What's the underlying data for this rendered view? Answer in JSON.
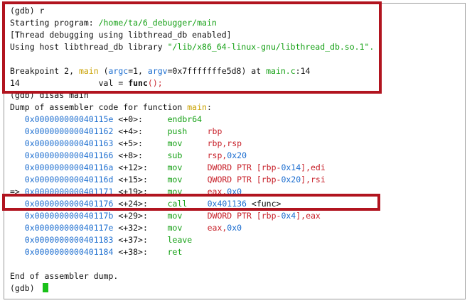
{
  "colors": {
    "address": "#1e6fd0",
    "instruction": "#16a116",
    "register": "#c8232c",
    "function_name": "#c9a100",
    "highlight_box": "#b1141f",
    "cursor": "#19c119"
  },
  "session": {
    "run_cmd": "(gdb) r",
    "starting_label": "Starting program: ",
    "program_path": "/home/ta/6_debugger/main",
    "thread_debug": "[Thread debugging using libthread_db enabled]",
    "host_lib_label": "Using host libthread_db library ",
    "host_lib_path": "\"/lib/x86_64-linux-gnu/libthread_db.so.1\".",
    "bp_label": "Breakpoint 2, ",
    "bp_fn": "main",
    "bp_open": " (",
    "argc_name": "argc",
    "argc_val": "=1, ",
    "argv_name": "argv",
    "argv_val": "=0x7fffffffe5d8) at ",
    "bp_file": "main.c",
    "bp_line": ":14",
    "src_lineno": "14",
    "src_pre": "                val = ",
    "src_func": "func",
    "src_parens": "();",
    "disas_cmd": "(gdb) disas main",
    "dump_label": "Dump of assembler code for function ",
    "dump_fn": "main",
    "dump_colon": ":",
    "end_dump": "End of assembler dump.",
    "prompt": "(gdb) "
  },
  "disassembly": [
    {
      "marker": "   ",
      "address": "0x000000000040115e",
      "offset": "<+0>:",
      "pad": "     ",
      "instr": "endbr64",
      "ops": []
    },
    {
      "marker": "   ",
      "address": "0x0000000000401162",
      "offset": "<+4>:",
      "pad": "     ",
      "instr": "push",
      "ops": [
        {
          "t": "reg",
          "v": "rbp"
        }
      ]
    },
    {
      "marker": "   ",
      "address": "0x0000000000401163",
      "offset": "<+5>:",
      "pad": "     ",
      "instr": "mov",
      "ops": [
        {
          "t": "reg",
          "v": "rbp,rsp"
        }
      ]
    },
    {
      "marker": "   ",
      "address": "0x0000000000401166",
      "offset": "<+8>:",
      "pad": "     ",
      "instr": "sub",
      "ops": [
        {
          "t": "reg",
          "v": "rsp,"
        },
        {
          "t": "num",
          "v": "0x20"
        }
      ]
    },
    {
      "marker": "   ",
      "address": "0x000000000040116a",
      "offset": "<+12>:",
      "pad": "    ",
      "instr": "mov",
      "ops": [
        {
          "t": "reg",
          "v": "DWORD PTR [rbp-"
        },
        {
          "t": "num",
          "v": "0x14"
        },
        {
          "t": "reg",
          "v": "],edi"
        }
      ]
    },
    {
      "marker": "   ",
      "address": "0x000000000040116d",
      "offset": "<+15>:",
      "pad": "    ",
      "instr": "mov",
      "ops": [
        {
          "t": "reg",
          "v": "QWORD PTR [rbp-"
        },
        {
          "t": "num",
          "v": "0x20"
        },
        {
          "t": "reg",
          "v": "],rsi"
        }
      ]
    },
    {
      "marker": "=> ",
      "address": "0x0000000000401171",
      "offset": "<+19>:",
      "pad": "    ",
      "instr": "mov",
      "ops": [
        {
          "t": "reg",
          "v": "eax,"
        },
        {
          "t": "num",
          "v": "0x0"
        }
      ]
    },
    {
      "marker": "   ",
      "address": "0x0000000000401176",
      "offset": "<+24>:",
      "pad": "    ",
      "instr": "call",
      "ops": [
        {
          "t": "num",
          "v": "0x401136"
        },
        {
          "t": "off",
          "v": " <func>"
        }
      ]
    },
    {
      "marker": "   ",
      "address": "0x000000000040117b",
      "offset": "<+29>:",
      "pad": "    ",
      "instr": "mov",
      "ops": [
        {
          "t": "reg",
          "v": "DWORD PTR [rbp-"
        },
        {
          "t": "num",
          "v": "0x4"
        },
        {
          "t": "reg",
          "v": "],eax"
        }
      ]
    },
    {
      "marker": "   ",
      "address": "0x000000000040117e",
      "offset": "<+32>:",
      "pad": "    ",
      "instr": "mov",
      "ops": [
        {
          "t": "reg",
          "v": "eax,"
        },
        {
          "t": "num",
          "v": "0x0"
        }
      ]
    },
    {
      "marker": "   ",
      "address": "0x0000000000401183",
      "offset": "<+37>:",
      "pad": "    ",
      "instr": "leave",
      "ops": []
    },
    {
      "marker": "   ",
      "address": "0x0000000000401184",
      "offset": "<+38>:",
      "pad": "    ",
      "instr": "ret",
      "ops": []
    }
  ]
}
